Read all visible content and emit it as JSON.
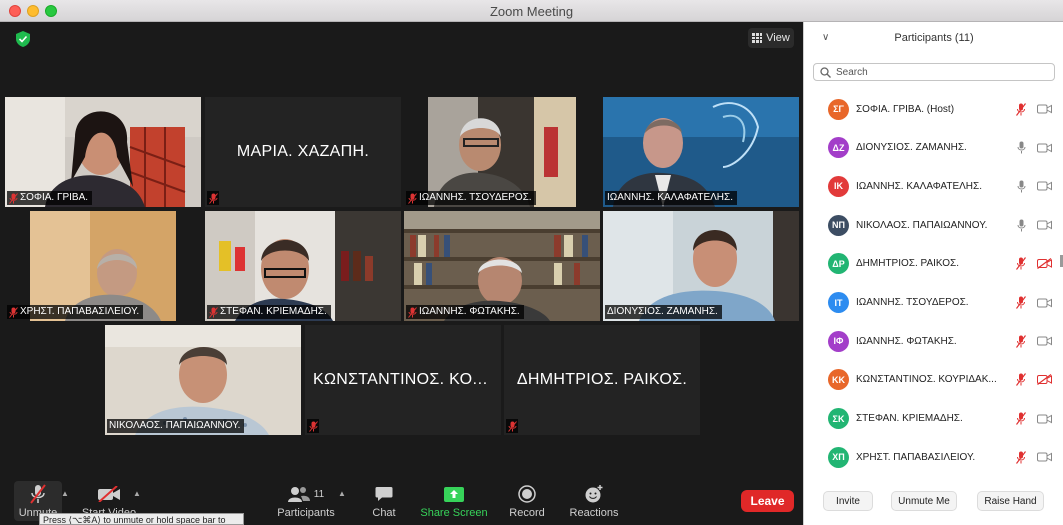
{
  "window": {
    "title": "Zoom Meeting"
  },
  "meeting": {
    "view_label": "View",
    "tiles": [
      {
        "name": "ΣΟΦΙΑ. ΓΡΙΒΑ.",
        "type": "video"
      },
      {
        "name": "ΜΑΡΙΑ. ΧΑΖΑΠΗ.",
        "type": "name-only"
      },
      {
        "name": "ΙΩΑΝΝΗΣ. ΤΣΟΥΔΕΡΟΣ.",
        "type": "video"
      },
      {
        "name": "ΙΩΑΝΝΗΣ. ΚΑΛΑΦΑΤΕΛΗΣ.",
        "type": "video",
        "active": true
      },
      {
        "name": "ΧΡΗΣΤ. ΠΑΠΑΒΑΣΙΛΕΙΟΥ.",
        "type": "video"
      },
      {
        "name": "ΣΤΕΦΑΝ. ΚΡΙΕΜΑΔΗΣ.",
        "type": "video"
      },
      {
        "name": "ΙΩΑΝΝΗΣ. ΦΩΤΑΚΗΣ.",
        "type": "video"
      },
      {
        "name": "ΔΙΟΝΥΣΙΟΣ. ΖΑΜΑΝΗΣ.",
        "type": "video"
      },
      {
        "name": "ΝΙΚΟΛΑΟΣ. ΠΑΠΑΙΩΑΝΝΟΥ.",
        "type": "video"
      },
      {
        "name": "ΚΩΝΣΤΑΝΤΙΝΟΣ. ΚΟΥ...",
        "type": "name-only"
      },
      {
        "name": "ΔΗΜΗΤΡΙΟΣ. ΡΑΙΚΟΣ.",
        "type": "name-only"
      }
    ]
  },
  "toolbar": {
    "unmute_label": "Unmute",
    "start_video_label": "Start Video",
    "participants_label": "Participants",
    "participants_count": "11",
    "chat_label": "Chat",
    "share_screen_label": "Share Screen",
    "record_label": "Record",
    "reactions_label": "Reactions",
    "leave_label": "Leave",
    "tooltip": "Press ⟨⌥⌘A⟩ to unmute or hold space bar to"
  },
  "panel": {
    "title": "Participants (11)",
    "search_placeholder": "Search",
    "participants": [
      {
        "initials": "ΣΓ",
        "name": "ΣΟΦΙΑ. ΓΡΙΒΑ. (Host)",
        "color": "#e8672a",
        "mic": "muted",
        "cam": "on"
      },
      {
        "initials": "ΔΖ",
        "name": "ΔΙΟΝΥΣΙΟΣ. ΖΑΜΑΝΗΣ.",
        "color": "#a33ec9",
        "mic": "on",
        "cam": "on"
      },
      {
        "initials": "ΙΚ",
        "name": "ΙΩΑΝΝΗΣ. ΚΑΛΑΦΑΤΕΛΗΣ.",
        "color": "#e23a3a",
        "mic": "on",
        "cam": "on"
      },
      {
        "initials": "ΝΠ",
        "name": "ΝΙΚΟΛΑΟΣ. ΠΑΠΑΙΩΑΝΝΟΥ.",
        "color": "#3c4d63",
        "mic": "on",
        "cam": "on"
      },
      {
        "initials": "ΔΡ",
        "name": "ΔΗΜΗΤΡΙΟΣ. ΡΑΙΚΟΣ.",
        "color": "#22b573",
        "mic": "muted",
        "cam": "off"
      },
      {
        "initials": "ΙΤ",
        "name": "ΙΩΑΝΝΗΣ. ΤΣΟΥΔΕΡΟΣ.",
        "color": "#2d8cf0",
        "mic": "muted",
        "cam": "on"
      },
      {
        "initials": "ΙΦ",
        "name": "ΙΩΑΝΝΗΣ. ΦΩΤΑΚΗΣ.",
        "color": "#a33ec9",
        "mic": "muted",
        "cam": "on"
      },
      {
        "initials": "ΚΚ",
        "name": "ΚΩΝΣΤΑΝΤΙΝΟΣ. ΚΟΥΡΙΔΑΚ...",
        "color": "#e8672a",
        "mic": "muted",
        "cam": "off"
      },
      {
        "initials": "ΣΚ",
        "name": "ΣΤΕΦΑΝ. ΚΡΙΕΜΑΔΗΣ.",
        "color": "#22b573",
        "mic": "muted",
        "cam": "on"
      },
      {
        "initials": "ΧΠ",
        "name": "ΧΡΗΣΤ. ΠΑΠΑΒΑΣΙΛΕΙΟΥ.",
        "color": "#22b573",
        "mic": "muted",
        "cam": "on"
      }
    ],
    "invite_label": "Invite",
    "unmute_me_label": "Unmute Me",
    "raise_hand_label": "Raise Hand"
  }
}
